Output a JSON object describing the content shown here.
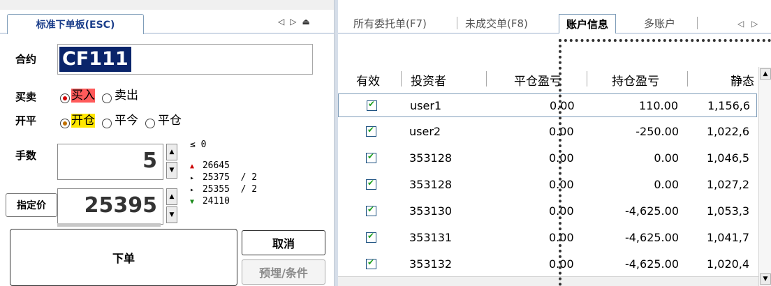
{
  "left": {
    "tab_label": "标准下单板(ESC)",
    "nav_icons": [
      "◁",
      "▷",
      "⏏"
    ],
    "contract_label": "合约",
    "contract_value": "CF111",
    "direction_label": "买卖",
    "direction_options": [
      "买入",
      "卖出"
    ],
    "offset_label": "开平",
    "offset_options": [
      "开仓",
      "平今",
      "平仓"
    ],
    "qty_label": "手数",
    "qty_value": "5",
    "price_label": "指定价",
    "price_value": "25395",
    "quote": {
      "le": "≤",
      "le_value": "0",
      "upper_limit": "26645",
      "ask_price": "25375",
      "ask_qty": "/ 2",
      "bid_price": "25355",
      "bid_qty": "/ 2",
      "lower_limit": "24110"
    },
    "submit_label": "下单",
    "cancel_label": "取消",
    "condition_label": "预埋/条件"
  },
  "right": {
    "tabs": [
      "所有委托单(F7)",
      "未成交单(F8)",
      "账户信息",
      "多账户"
    ],
    "nav_icons": [
      "◁",
      "▷"
    ],
    "columns": [
      "有效",
      "投资者",
      "平仓盈亏",
      "持仓盈亏",
      "静态"
    ],
    "rows": [
      {
        "investor": "user1",
        "close_pnl": "0.00",
        "position_pnl": "110.00",
        "static": "1,156,6"
      },
      {
        "investor": "user2",
        "close_pnl": "0.00",
        "position_pnl": "-250.00",
        "static": "1,022,6"
      },
      {
        "investor": "353128",
        "close_pnl": "0.00",
        "position_pnl": "0.00",
        "static": "1,046,5"
      },
      {
        "investor": "353128",
        "close_pnl": "0.00",
        "position_pnl": "0.00",
        "static": "1,027,2"
      },
      {
        "investor": "353130",
        "close_pnl": "0.00",
        "position_pnl": "-4,625.00",
        "static": "1,053,3"
      },
      {
        "investor": "353131",
        "close_pnl": "0.00",
        "position_pnl": "-4,625.00",
        "static": "1,041,7"
      },
      {
        "investor": "353132",
        "close_pnl": "0.00",
        "position_pnl": "-4,625.00",
        "static": "1,020,4"
      }
    ]
  }
}
